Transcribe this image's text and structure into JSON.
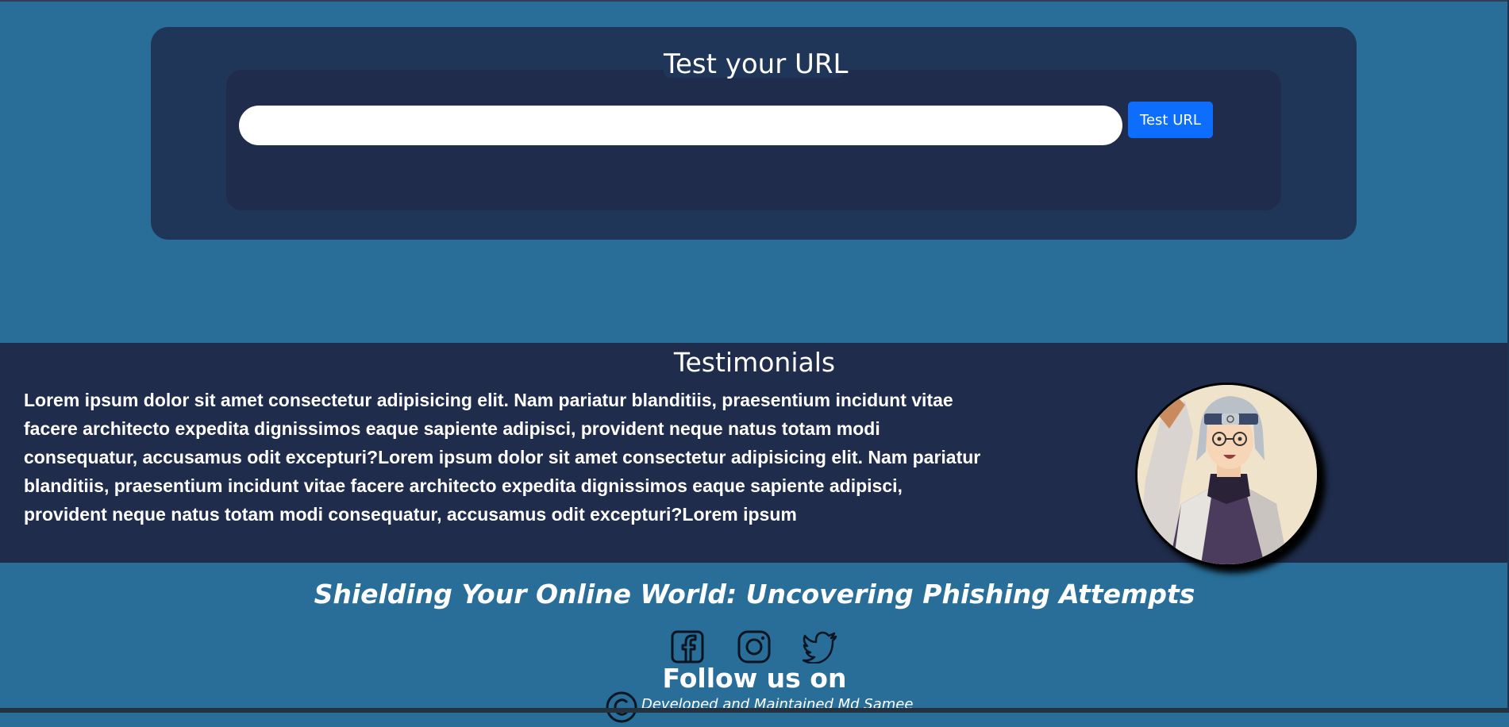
{
  "url_tester": {
    "title": "Test your URL",
    "input_value": "",
    "input_placeholder": "",
    "button_label": "Test URL"
  },
  "testimonials": {
    "title": "Testimonials",
    "text": "Lorem ipsum dolor sit amet consectetur adipisicing elit. Nam pariatur blanditiis, praesentium incidunt vitae facere architecto expedita dignissimos eaque sapiente adipisci, provident neque natus totam modi consequatur, accusamus odit excepturi?Lorem ipsum dolor sit amet consectetur adipisicing elit. Nam pariatur blanditiis, praesentium incidunt vitae facere architecto expedita dignissimos eaque sapiente adipisci, provident neque natus totam modi consequatur, accusamus odit excepturi?Lorem ipsum",
    "avatar_icon": "anime-character-avatar"
  },
  "footer": {
    "tagline": "Shielding Your Online World: Uncovering Phishing Attempts",
    "social_icons": [
      "facebook-icon",
      "instagram-icon",
      "twitter-icon"
    ],
    "follow_text": "Follow us on",
    "copyright_icon": "copyright-icon",
    "credit": "Developed and Maintained Md Samee"
  },
  "colors": {
    "page_background": "#286e99",
    "outer_card": "#1f3658",
    "inner_card": "#1f2c4b",
    "testimonials_background": "#1f2c4b",
    "button": "#0d6efd"
  }
}
